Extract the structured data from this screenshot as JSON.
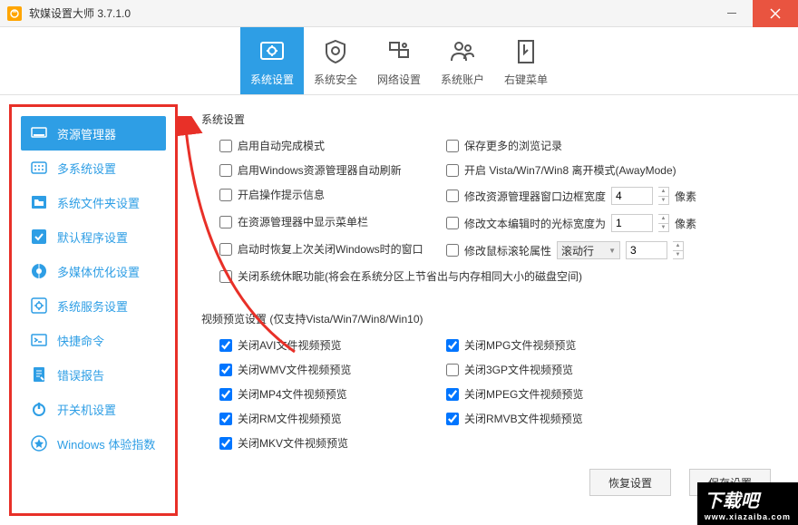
{
  "app": {
    "title": "软媒设置大师 3.7.1.0"
  },
  "topnav": [
    {
      "label": "系统设置",
      "active": true
    },
    {
      "label": "系统安全",
      "active": false
    },
    {
      "label": "网络设置",
      "active": false
    },
    {
      "label": "系统账户",
      "active": false
    },
    {
      "label": "右键菜单",
      "active": false
    }
  ],
  "sidebar": [
    {
      "label": "资源管理器",
      "active": true
    },
    {
      "label": "多系统设置",
      "active": false
    },
    {
      "label": "系统文件夹设置",
      "active": false
    },
    {
      "label": "默认程序设置",
      "active": false
    },
    {
      "label": "多媒体优化设置",
      "active": false
    },
    {
      "label": "系统服务设置",
      "active": false
    },
    {
      "label": "快捷命令",
      "active": false
    },
    {
      "label": "错误报告",
      "active": false
    },
    {
      "label": "开关机设置",
      "active": false
    },
    {
      "label": "Windows 体验指数",
      "active": false
    }
  ],
  "sections": {
    "sys": {
      "title": "系统设置",
      "left": [
        "启用自动完成模式",
        "启用Windows资源管理器自动刷新",
        "开启操作提示信息",
        "在资源管理器中显示菜单栏",
        "启动时恢复上次关闭Windows时的窗口",
        "关闭系统休眠功能(将会在系统分区上节省出与内存相同大小的磁盘空间)"
      ],
      "right": [
        {
          "label": "保存更多的浏览记录"
        },
        {
          "label": "开启 Vista/Win7/Win8 离开模式(AwayMode)"
        },
        {
          "label": "修改资源管理器窗口边框宽度",
          "value": "4",
          "unit": "像素"
        },
        {
          "label": "修改文本编辑时的光标宽度为",
          "value": "1",
          "unit": "像素"
        },
        {
          "label": "修改鼠标滚轮属性",
          "select": "滚动行",
          "value": "3"
        }
      ]
    },
    "video": {
      "title": "视频预览设置 (仅支持Vista/Win7/Win8/Win10)",
      "left": [
        {
          "label": "关闭AVI文件视频预览",
          "checked": true
        },
        {
          "label": "关闭WMV文件视频预览",
          "checked": true
        },
        {
          "label": "关闭MP4文件视频预览",
          "checked": true
        },
        {
          "label": "关闭RM文件视频预览",
          "checked": true
        },
        {
          "label": "关闭MKV文件视频预览",
          "checked": true
        }
      ],
      "right": [
        {
          "label": "关闭MPG文件视频预览",
          "checked": true
        },
        {
          "label": "关闭3GP文件视频预览",
          "checked": false
        },
        {
          "label": "关闭MPEG文件视频预览",
          "checked": true
        },
        {
          "label": "关闭RMVB文件视频预览",
          "checked": true
        }
      ]
    }
  },
  "buttons": {
    "restore": "恢复设置",
    "save": "保存设置"
  },
  "watermark": {
    "main": "下载吧",
    "sub": "www.xiazaiba.com"
  }
}
